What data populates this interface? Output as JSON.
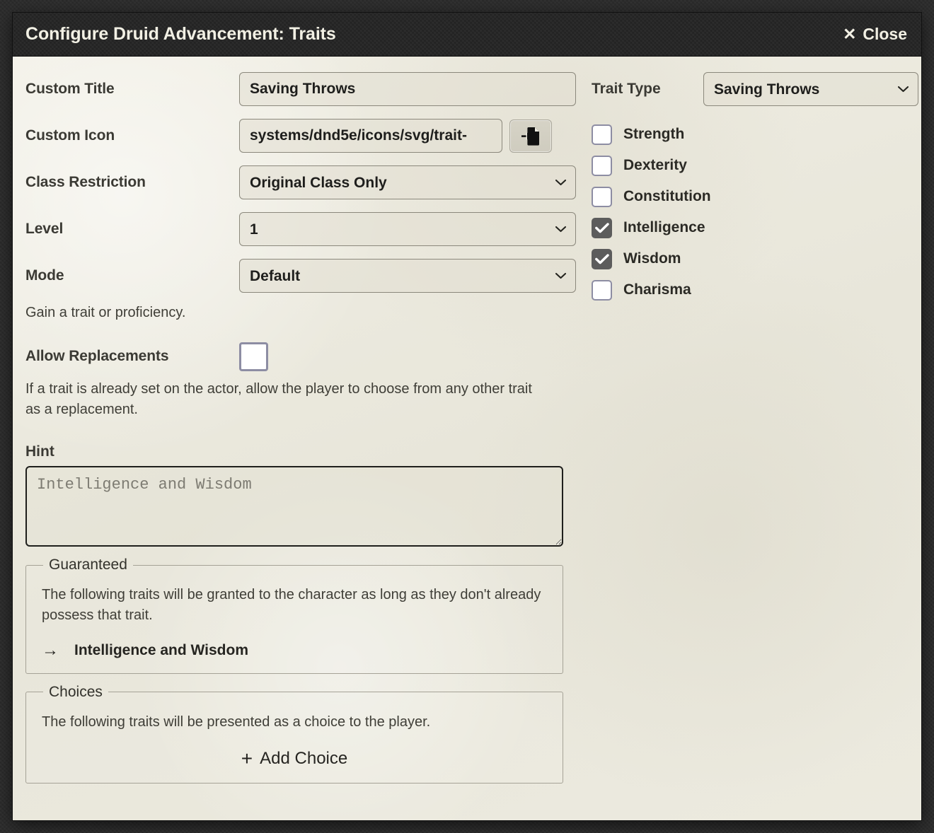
{
  "window": {
    "title": "Configure Druid Advancement: Traits",
    "close_label": "Close",
    "close_icon": "close-x-icon"
  },
  "form": {
    "custom_title": {
      "label": "Custom Title",
      "value": "Saving Throws",
      "placeholder": ""
    },
    "custom_icon": {
      "label": "Custom Icon",
      "value": "systems/dnd5e/icons/svg/trait-",
      "placeholder": "",
      "picker_icon": "file-import-icon"
    },
    "class_restriction": {
      "label": "Class Restriction",
      "value": "Original Class Only",
      "options": [
        "Original Class Only"
      ]
    },
    "level": {
      "label": "Level",
      "value": "1",
      "options": [
        "1"
      ]
    },
    "mode": {
      "label": "Mode",
      "value": "Default",
      "options": [
        "Default"
      ],
      "hint": "Gain a trait or proficiency."
    },
    "allow_replacements": {
      "label": "Allow Replacements",
      "checked": false,
      "hint": "If a trait is already set on the actor, allow the player to choose from any other trait as a replacement."
    },
    "hint": {
      "label": "Hint",
      "value": "",
      "placeholder": "Intelligence and Wisdom"
    }
  },
  "guaranteed": {
    "legend": "Guaranteed",
    "description": "The following traits will be granted to the character as long as they don't already possess that trait.",
    "items": [
      {
        "arrow": "→",
        "label": "Intelligence and Wisdom"
      }
    ]
  },
  "choices": {
    "legend": "Choices",
    "description": "The following traits will be presented as a choice to the player.",
    "add_label": "Add Choice",
    "add_icon": "plus-icon"
  },
  "trait_type": {
    "label": "Trait Type",
    "value": "Saving Throws",
    "options": [
      "Saving Throws"
    ]
  },
  "traits": [
    {
      "label": "Strength",
      "checked": false
    },
    {
      "label": "Dexterity",
      "checked": false
    },
    {
      "label": "Constitution",
      "checked": false
    },
    {
      "label": "Intelligence",
      "checked": true
    },
    {
      "label": "Wisdom",
      "checked": true
    },
    {
      "label": "Charisma",
      "checked": false
    }
  ],
  "colors": {
    "header_bg": "#242424",
    "header_text": "#f2f0e4",
    "content_bg": "#eeece1",
    "checkbox_checked": "#5c5c5c",
    "checkbox_border": "#8d8da3",
    "field_border": "#8b887c",
    "body_text": "#3b3a34"
  }
}
